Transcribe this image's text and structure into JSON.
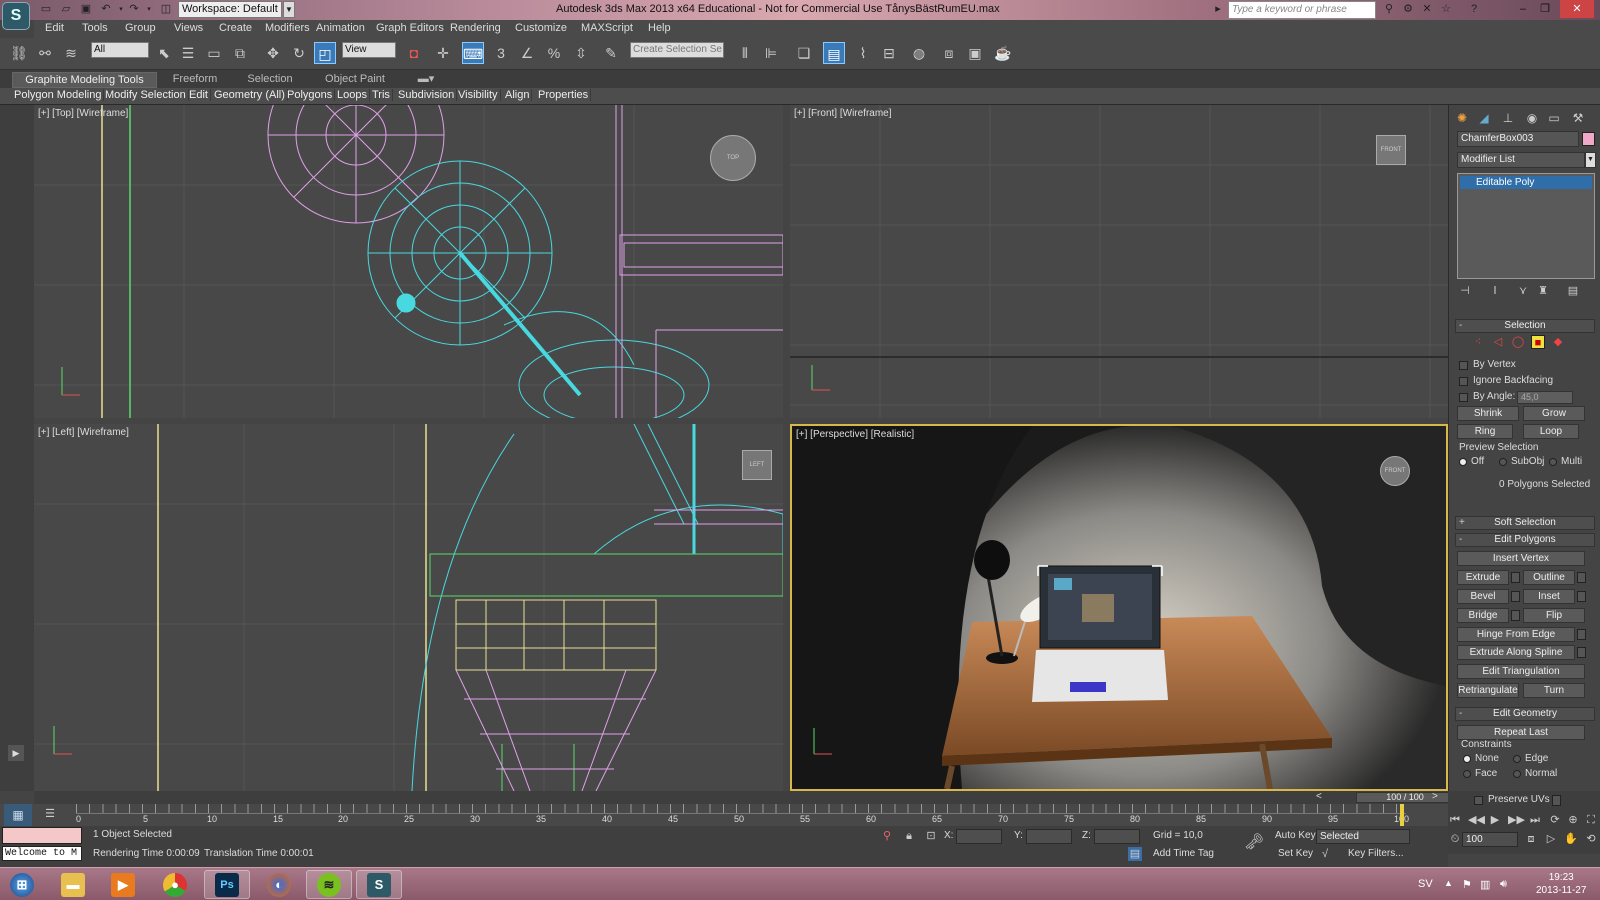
{
  "window": {
    "title": "Autodesk 3ds Max  2013 x64    Educational - Not for Commercial Use    TånysBästRumEU.max",
    "workspace": "Workspace: Default",
    "search_placeholder": "Type a keyword or phrase",
    "minimize": "–",
    "restore": "❐",
    "close": "✕"
  },
  "menu": [
    "Edit",
    "Tools",
    "Group",
    "Views",
    "Create",
    "Modifiers",
    "Animation",
    "Graph Editors",
    "Rendering",
    "Customize",
    "MAXScript",
    "Help"
  ],
  "toolbar": {
    "selection_filter": "All",
    "ref_coord": "View",
    "named_selection": "Create Selection Se"
  },
  "ribbon": {
    "tabs": [
      "Graphite Modeling Tools",
      "Freeform",
      "Selection",
      "Object Paint"
    ],
    "active_tab": "Graphite Modeling Tools",
    "panels": [
      "Polygon Modeling",
      "Modify Selection",
      "Edit",
      "Geometry (All)",
      "Polygons",
      "Loops",
      "Tris",
      "Subdivision",
      "Visibility",
      "Align",
      "Properties"
    ]
  },
  "viewports": {
    "top": {
      "label": "[+] [Top] [Wireframe]",
      "cube": "TOP"
    },
    "front": {
      "label": "[+] [Front] [Wireframe]",
      "cube": "FRONT"
    },
    "left": {
      "label": "[+] [Left] [Wireframe]",
      "cube": "LEFT"
    },
    "perspective": {
      "label": "[+] [Perspective] [Realistic]",
      "cube": "FRONT"
    }
  },
  "command_panel": {
    "object_name": "ChamferBox003",
    "object_color": "#f0a8c8",
    "modifier_list": "Modifier List",
    "stack_item": "Editable Poly",
    "selection": {
      "title": "Selection",
      "by_vertex": "By Vertex",
      "ignore_backfacing": "Ignore Backfacing",
      "by_angle": "By Angle:",
      "angle_value": "45,0",
      "shrink": "Shrink",
      "grow": "Grow",
      "ring": "Ring",
      "loop": "Loop",
      "preview_title": "Preview Selection",
      "preview_off": "Off",
      "preview_subobj": "SubObj",
      "preview_multi": "Multi",
      "status": "0 Polygons Selected"
    },
    "soft_selection": "Soft Selection",
    "edit_polygons": {
      "title": "Edit Polygons",
      "insert_vertex": "Insert Vertex",
      "extrude": "Extrude",
      "outline": "Outline",
      "bevel": "Bevel",
      "inset": "Inset",
      "bridge": "Bridge",
      "flip": "Flip",
      "hinge": "Hinge From Edge",
      "extrude_spline": "Extrude Along Spline",
      "edit_triangulation": "Edit Triangulation",
      "retriangulate": "Retriangulate",
      "turn": "Turn"
    },
    "edit_geometry": {
      "title": "Edit Geometry",
      "repeat_last": "Repeat Last",
      "constraints": "Constraints",
      "none": "None",
      "edge": "Edge",
      "face": "Face",
      "normal": "Normal",
      "preserve_uvs": "Preserve UVs"
    }
  },
  "timeline": {
    "frame": "100 / 100",
    "ticks": [
      "0",
      "5",
      "10",
      "15",
      "20",
      "25",
      "30",
      "35",
      "40",
      "45",
      "50",
      "55",
      "60",
      "65",
      "70",
      "75",
      "80",
      "85",
      "90",
      "95",
      "100"
    ],
    "prev": "<",
    "next": ">"
  },
  "status": {
    "welcome": "Welcome to M",
    "selected": "1 Object Selected",
    "rendering_time": "Rendering Time  0:00:09",
    "translation_time": "Translation Time  0:00:01",
    "x_label": "X:",
    "y_label": "Y:",
    "z_label": "Z:",
    "grid": "Grid = 10,0",
    "add_time_tag": "Add Time Tag",
    "auto_key": "Auto Key",
    "set_key": "Set Key",
    "key_mode": "Selected",
    "key_filters": "Key Filters...",
    "current_frame": "100"
  },
  "taskbar": {
    "time": "19:23",
    "date": "2013-11-27",
    "lang": "SV"
  },
  "colors": {
    "viewport_bg": "#484848",
    "active_border": "#d8b84a",
    "wire_cyan": "#48d8e0",
    "wire_pink": "#e0a0e8",
    "wire_yellow": "#e8e090",
    "accent_blue": "#2f6ea8"
  }
}
